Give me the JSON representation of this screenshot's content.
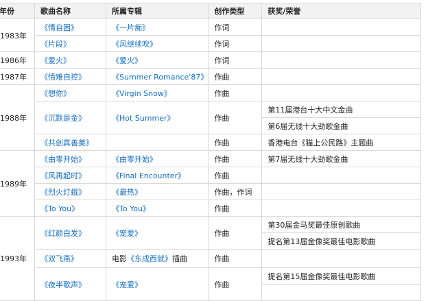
{
  "headers": [
    "年份",
    "歌曲名称",
    "所属专辑",
    "创作类型",
    "获奖/荣誉"
  ],
  "rows": [
    {
      "year": "1983年",
      "song": "《情自困》",
      "album": "《一片痴》",
      "type": "作词",
      "awards": [
        ""
      ]
    },
    {
      "song": "《片段》",
      "album": "《风继续吹》",
      "type": "作词",
      "awards": [
        ""
      ]
    },
    {
      "year": "1986年",
      "song": "《爱火》",
      "album": "《爱火》",
      "type": "作词",
      "awards": [
        ""
      ]
    },
    {
      "year": "1987年",
      "song": "《情难自控》",
      "album": "《Summer Romance'87》",
      "type": "作曲",
      "awards": [
        ""
      ]
    },
    {
      "year": "1988年",
      "song": "《想你》",
      "album": "《Virgin Snow》",
      "type": "作曲",
      "awards": [
        ""
      ]
    },
    {
      "song": "《沉默是金》",
      "album": "《Hot Summer》",
      "type": "作曲",
      "awards": [
        "第11届港台十大中文金曲",
        "第6届无线十大劲歌金曲"
      ]
    },
    {
      "song": "《共创真善美》",
      "album": "",
      "type": "作曲",
      "awards": [
        "香港电台《猫上公民路》主题曲"
      ]
    },
    {
      "year": "1989年",
      "song": "《由零开始》",
      "album": "《由零开始》",
      "type": "作曲",
      "awards": [
        "第7届无线十大劲歌金曲"
      ]
    },
    {
      "song": "《风再起时》",
      "album": "《Final Encounter》",
      "type": "作曲",
      "awards": [
        ""
      ]
    },
    {
      "song": "《烈火灯蛾》",
      "album": "《最热》",
      "type": "作曲，作词",
      "awards": [
        ""
      ]
    },
    {
      "song": "《To You》",
      "album": "《To You》",
      "type": "作曲",
      "awards": [
        ""
      ]
    },
    {
      "year": "1993年",
      "song": "《红颜白发》",
      "album": "《宠爱》",
      "type": "作曲",
      "awards": [
        "第30届金马奖最佳原创歌曲",
        "提名第13届金像奖最佳电影歌曲"
      ]
    },
    {
      "song": "《双飞燕》",
      "album_prefix": "电影",
      "album": "《东成西就》",
      "album_suffix": "插曲",
      "type": "作曲",
      "awards": [
        ""
      ]
    },
    {
      "song": "《夜半歌声》",
      "album": "《宠爱》",
      "type": "作曲",
      "awards": [
        "提名第15届金像奖最佳电影歌曲",
        ""
      ]
    }
  ]
}
